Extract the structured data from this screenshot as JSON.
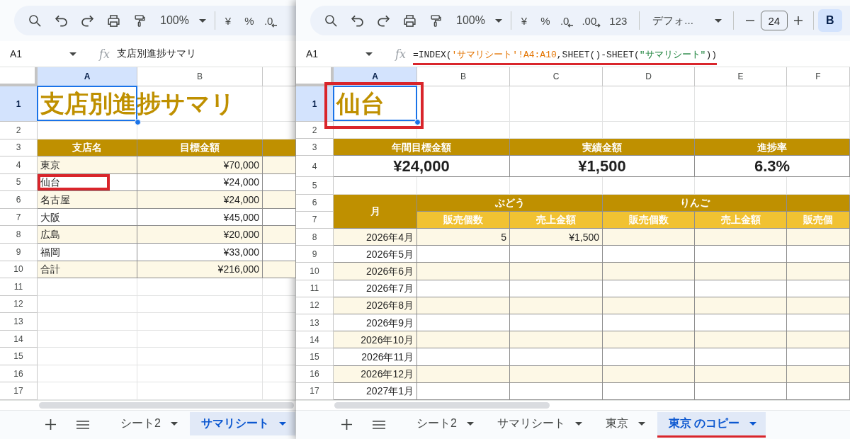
{
  "windows": [
    {
      "toolbar": {
        "zoom": "100%",
        "format_buttons": [
          {
            "kind": "currency",
            "label": "¥"
          },
          {
            "kind": "percent",
            "label": "%"
          },
          {
            "kind": "decrease_decimal",
            "label": ".0"
          }
        ]
      },
      "formula_bar": {
        "cell": "A1",
        "fx": "fx",
        "kind": "text",
        "formula": [
          {
            "kind": "plain",
            "text": "支店別進捗サマリ"
          }
        ],
        "highlighted": false
      },
      "columns": [
        {
          "label": "A",
          "selected": true
        },
        {
          "label": "B",
          "selected": false
        },
        {
          "selected": false
        }
      ],
      "row_numbers": [
        {
          "label": "1",
          "selected": true
        },
        {
          "label": "2",
          "selected": false
        },
        {
          "label": "3",
          "selected": false
        },
        {
          "label": "4",
          "selected": false
        },
        {
          "label": "5",
          "selected": false
        },
        {
          "label": "6",
          "selected": false
        },
        {
          "label": "7",
          "selected": false
        },
        {
          "label": "8",
          "selected": false
        },
        {
          "label": "9",
          "selected": false
        },
        {
          "label": "10",
          "selected": false
        },
        {
          "label": "11",
          "selected": false
        },
        {
          "label": "12",
          "selected": false
        },
        {
          "label": "13",
          "selected": false
        },
        {
          "label": "14",
          "selected": false
        },
        {
          "label": "15",
          "selected": false
        },
        {
          "label": "16",
          "selected": false
        },
        {
          "label": "17",
          "selected": false
        }
      ],
      "sheet": {
        "title": {
          "text": "支店別進捗サマリ",
          "selected": true,
          "highlighted": false
        },
        "table": {
          "headers": [
            "支店名",
            "目標金額"
          ],
          "rows": [
            {
              "cells": [
                "東京",
                "¥70,000"
              ],
              "banded": true,
              "highlighted": false
            },
            {
              "cells": [
                "仙台",
                "¥24,000"
              ],
              "banded": false,
              "highlighted": true
            },
            {
              "cells": [
                "名古屋",
                "¥24,000"
              ],
              "banded": true,
              "highlighted": false
            },
            {
              "cells": [
                "大阪",
                "¥45,000"
              ],
              "banded": false,
              "highlighted": false
            },
            {
              "cells": [
                "広島",
                "¥20,000"
              ],
              "banded": true,
              "highlighted": false
            },
            {
              "cells": [
                "福岡",
                "¥33,000"
              ],
              "banded": false,
              "highlighted": false
            },
            {
              "cells": [
                "合計",
                "¥216,000"
              ],
              "banded": true,
              "highlighted": false
            }
          ]
        }
      },
      "sheet_tabs": [
        {
          "label": "シート2",
          "selected": false,
          "highlighted": false
        },
        {
          "label": "サマリシート",
          "selected": true,
          "highlighted": false
        }
      ]
    },
    {
      "toolbar": {
        "zoom": "100%",
        "format_buttons": [
          {
            "kind": "currency",
            "label": "¥"
          },
          {
            "kind": "percent",
            "label": "%"
          },
          {
            "kind": "decrease_decimal",
            "label": ".0"
          },
          {
            "kind": "increase_decimal",
            "label": ".00"
          },
          {
            "kind": "number_format",
            "label": "123"
          }
        ],
        "font": "デフォ...",
        "font_size": "24",
        "bold": {
          "label": "B",
          "on": true
        }
      },
      "formula_bar": {
        "cell": "A1",
        "fx": "fx",
        "kind": "formula",
        "formula": [
          {
            "kind": "plain",
            "text": "=INDEX("
          },
          {
            "kind": "reference",
            "text": "'サマリシート'!A4:A10"
          },
          {
            "kind": "plain",
            "text": ",SHEET()-SHEET("
          },
          {
            "kind": "string",
            "text": "\"サマリシート\""
          },
          {
            "kind": "plain",
            "text": "))"
          }
        ],
        "highlighted": true
      },
      "columns": [
        {
          "label": "A",
          "selected": true
        },
        {
          "label": "B",
          "selected": false
        },
        {
          "label": "C",
          "selected": false
        },
        {
          "label": "D",
          "selected": false
        },
        {
          "label": "E",
          "selected": false
        },
        {
          "label": "F",
          "selected": false
        }
      ],
      "row_numbers": [
        {
          "label": "1",
          "selected": true
        },
        {
          "label": "2",
          "selected": false
        },
        {
          "label": "3",
          "selected": false
        },
        {
          "label": "4",
          "selected": false
        },
        {
          "label": "5",
          "selected": false
        },
        {
          "label": "6",
          "selected": false
        },
        {
          "label": "7",
          "selected": false
        },
        {
          "label": "8",
          "selected": false
        },
        {
          "label": "9",
          "selected": false
        },
        {
          "label": "10",
          "selected": false
        },
        {
          "label": "11",
          "selected": false
        },
        {
          "label": "12",
          "selected": false
        },
        {
          "label": "13",
          "selected": false
        },
        {
          "label": "14",
          "selected": false
        },
        {
          "label": "15",
          "selected": false
        },
        {
          "label": "16",
          "selected": false
        },
        {
          "label": "17",
          "selected": false
        }
      ],
      "sheet": {
        "title": {
          "text": "仙台",
          "selected": true,
          "highlighted": true
        },
        "kpis": [
          {
            "label": "年間目標金額",
            "value": "¥24,000"
          },
          {
            "label": "実績金額",
            "value": "¥1,500"
          },
          {
            "label": "進捗率",
            "value": "6.3%"
          }
        ],
        "sales": {
          "month_header": "月",
          "products": [
            {
              "name": "ぶどう",
              "columns": [
                "販売個数",
                "売上金額"
              ]
            },
            {
              "name": "りんご",
              "columns": [
                "販売個数",
                "売上金額"
              ]
            },
            {
              "columns": [
                "販売個"
              ]
            }
          ],
          "rows": [
            {
              "month": "2026年4月",
              "values": [
                "5",
                "¥1,500"
              ],
              "banded": true
            },
            {
              "month": "2026年5月",
              "banded": false
            },
            {
              "month": "2026年6月",
              "banded": true
            },
            {
              "month": "2026年7月",
              "banded": false
            },
            {
              "month": "2026年8月",
              "banded": true
            },
            {
              "month": "2026年9月",
              "banded": false
            },
            {
              "month": "2026年10月",
              "banded": true
            },
            {
              "month": "2026年11月",
              "banded": false
            },
            {
              "month": "2026年12月",
              "banded": true
            },
            {
              "month": "2027年1月",
              "banded": false
            }
          ]
        }
      },
      "sheet_tabs": [
        {
          "label": "シート2",
          "selected": false,
          "highlighted": false
        },
        {
          "label": "サマリシート",
          "selected": false,
          "highlighted": false
        },
        {
          "label": "東京",
          "selected": false,
          "highlighted": false
        },
        {
          "label": "東京 のコピー",
          "selected": true,
          "highlighted": true
        }
      ]
    }
  ]
}
